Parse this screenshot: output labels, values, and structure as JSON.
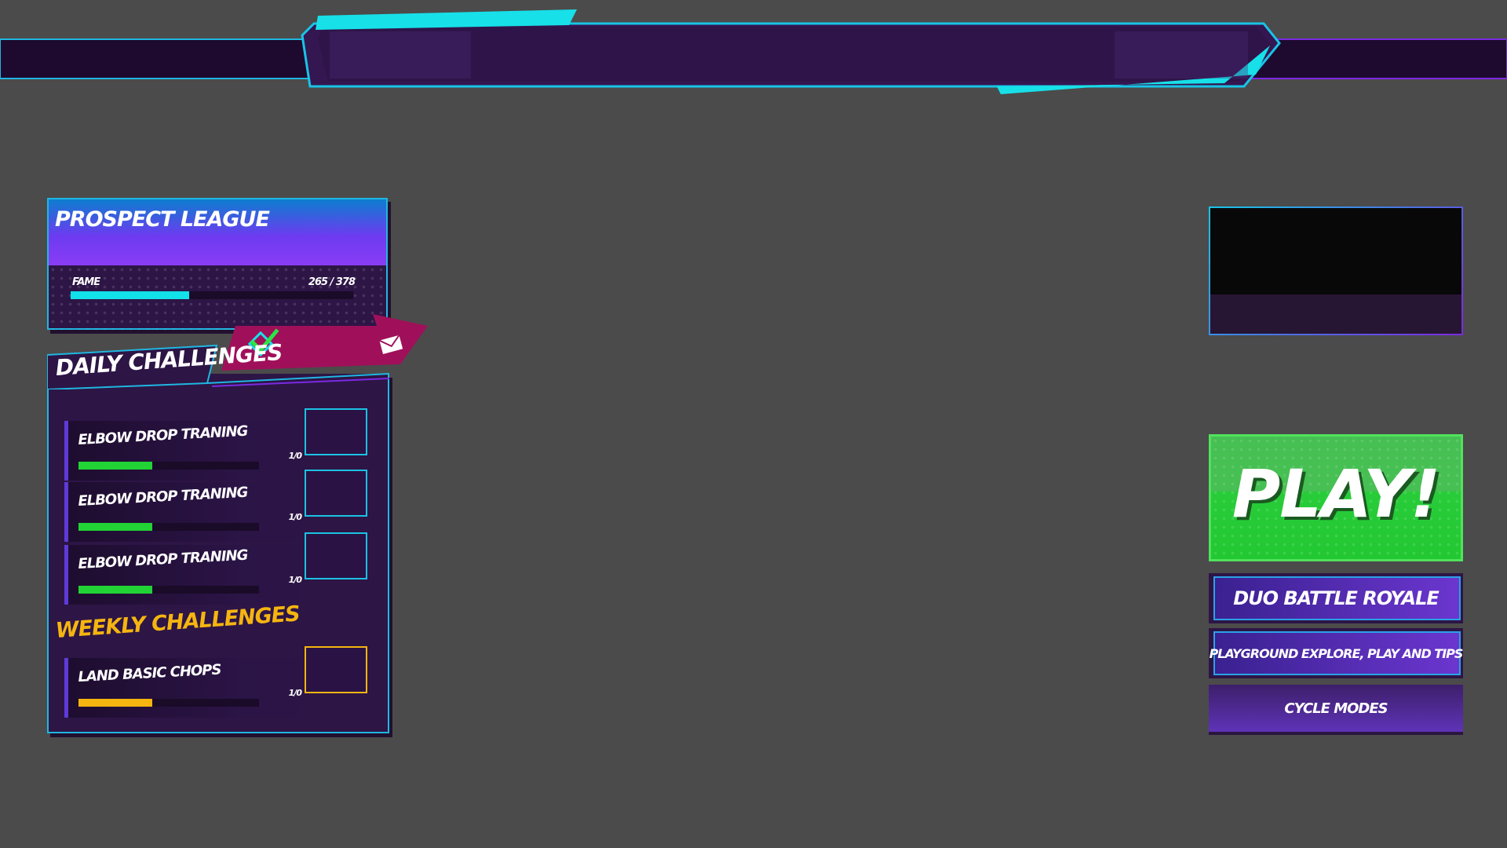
{
  "league": {
    "title": "PROSPECT LEAGUE",
    "fame_label": "FAME",
    "fame_value": "265 / 378",
    "fame_progress": 0.42
  },
  "ribbon": {
    "check_icon": "check-icon",
    "mail_icon": "envelope-icon",
    "color": "#a0105a"
  },
  "daily": {
    "title": "DAILY CHALLENGES",
    "items": [
      {
        "name": "ELBOW DROP TRANING",
        "progress": "1/0",
        "fill": 0.41
      },
      {
        "name": "ELBOW DROP TRANING",
        "progress": "1/0",
        "fill": 0.41
      },
      {
        "name": "ELBOW DROP TRANING",
        "progress": "1/0",
        "fill": 0.41
      }
    ]
  },
  "weekly": {
    "title": "WEEKLY CHALLENGES",
    "items": [
      {
        "name": "LAND BASIC CHOPS",
        "progress": "1/0",
        "fill": 0.41
      }
    ]
  },
  "right": {
    "play_label": "PLAY!",
    "mode_primary": "DUO BATTLE ROYALE",
    "mode_secondary": "PLAYGROUND EXPLORE, PLAY AND TIPS",
    "cycle_label": "CYCLE MODES"
  },
  "colors": {
    "cyan": "#12e1ea",
    "purple_dark": "#2d1546",
    "green": "#22d335",
    "gold": "#f5b510",
    "magenta": "#a0105a"
  }
}
